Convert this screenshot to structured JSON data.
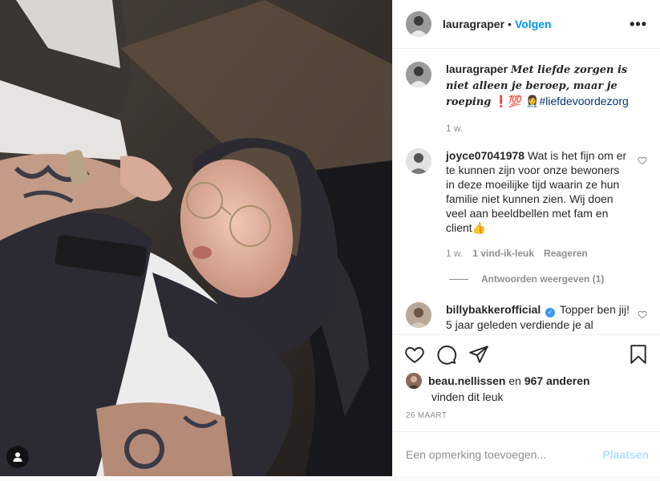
{
  "header": {
    "username": "lauragraper",
    "separator": "•",
    "follow_label": "Volgen",
    "more_label": "•••"
  },
  "caption": {
    "username": "lauragraper",
    "text": "Met liefde zorgen is niet alleen je beroep, maar je roeping",
    "emoji": "❗💯",
    "hashtag_emoji": "👩‍⚕️",
    "hashtag": "#liefdevoordezorg",
    "time": "1 w."
  },
  "comments": [
    {
      "username": "joyce07041978",
      "text": "Wat is het fijn om er te kunnen zijn voor onze bewoners in deze moeilijke tijd waarin ze hun familie niet kunnen zien. Wij doen veel aan beeldbellen met fam en client👍",
      "time": "1 w.",
      "likes": "1 vind-ik-leuk",
      "reply_label": "Reageren",
      "view_replies": "Antwoorden weergeven (1)"
    },
    {
      "username": "billybakkerofficial",
      "verified_glyph": "✓",
      "text": "Topper ben jij! 5 jaar geleden verdiende je al"
    }
  ],
  "likes": {
    "first_user": "beau.nellissen",
    "connector": " en ",
    "others": "967 anderen",
    "suffix": "vinden dit leuk"
  },
  "date": "26 MAART",
  "comment_box": {
    "placeholder": "Een opmerking toevoegen...",
    "post_label": "Plaatsen"
  },
  "icons": {
    "like": "heart-icon",
    "comment": "comment-icon",
    "share": "share-icon",
    "save": "bookmark-icon",
    "user_tags": "user-icon",
    "more": "more-icon"
  },
  "colors": {
    "link_blue": "#0095f6",
    "post_disabled": "#b2dffc",
    "muted": "#8e8e8e",
    "verified": "#3897f0"
  }
}
